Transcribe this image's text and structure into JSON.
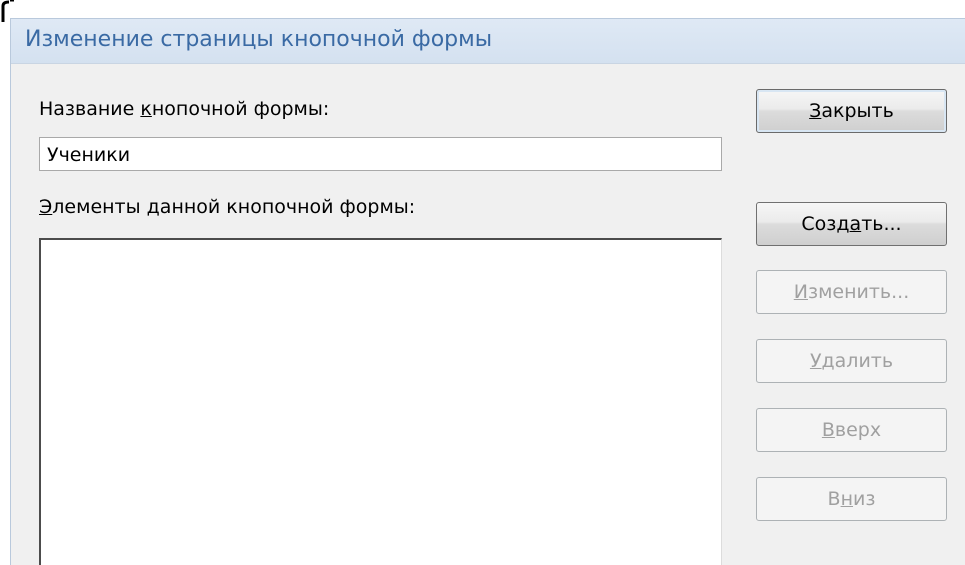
{
  "window": {
    "title": "Изменение страницы кнопочной формы"
  },
  "form": {
    "name_label_before": "Название ",
    "name_label_mnemonic": "к",
    "name_label_after": "нопочной формы:",
    "name_value": "Ученики",
    "items_label_mnemonic": "Э",
    "items_label_after": "лементы данной кнопочной формы:",
    "items": []
  },
  "buttons": {
    "close": {
      "before": "",
      "mnemonic": "З",
      "after": "акрыть",
      "enabled": true
    },
    "create": {
      "before": "Созд",
      "mnemonic": "а",
      "after": "ть...",
      "enabled": true
    },
    "edit": {
      "before": "",
      "mnemonic": "И",
      "after": "зменить...",
      "enabled": false
    },
    "delete": {
      "before": "",
      "mnemonic": "У",
      "after": "далить",
      "enabled": false
    },
    "up": {
      "before": "",
      "mnemonic": "В",
      "after": "верх",
      "enabled": false
    },
    "down": {
      "before": "В",
      "mnemonic": "н",
      "after": "из",
      "enabled": false
    }
  },
  "icons": {
    "corner": "bracket-corner-icon"
  },
  "colors": {
    "title_text": "#3a6aa4",
    "title_bar": "#dfe9f5",
    "dialog_bg": "#f0f0f0",
    "disabled_text": "#a0a0a0"
  }
}
